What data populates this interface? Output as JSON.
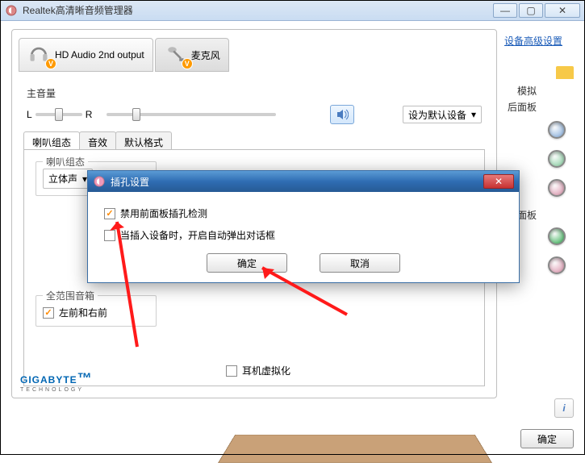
{
  "window": {
    "title": "Realtek高清晰音频管理器",
    "min": "—",
    "max": "▢",
    "close": "✕"
  },
  "header": {
    "advanced_link": "设备高级设置"
  },
  "devices": {
    "tab1_label": "HD Audio 2nd output",
    "tab2_label": "麦克风"
  },
  "volume": {
    "label": "主音量",
    "left": "L",
    "right": "R",
    "dropdown_label": "设为默认设备",
    "chevron": "▾"
  },
  "subtabs": {
    "t1": "喇叭组态",
    "t2": "音效",
    "t3": "默认格式"
  },
  "speaker_config": {
    "legend": "喇叭组态",
    "combo_value": "立体声",
    "fullrange_legend": "全范围音箱",
    "check_lr": "左前和右前",
    "headphone_virt": "耳机虚拟化"
  },
  "side": {
    "analog": "模拟",
    "back_panel": "后面板",
    "front_panel": "前面板"
  },
  "jack_colors": {
    "j1": "#7ea8d8",
    "j2": "#7fc99a",
    "j3": "#d88fa8",
    "j4": "#2aa84a",
    "j5": "#d88fa8"
  },
  "modal": {
    "title": "插孔设置",
    "check1": "禁用前面板插孔检测",
    "check2": "当插入设备时，开启自动弹出对话框",
    "ok": "确定",
    "cancel": "取消",
    "close": "✕"
  },
  "footer": {
    "brand": "GIGABYTE",
    "brand_sub": "TECHNOLOGY",
    "info": "i",
    "ok": "确定"
  }
}
